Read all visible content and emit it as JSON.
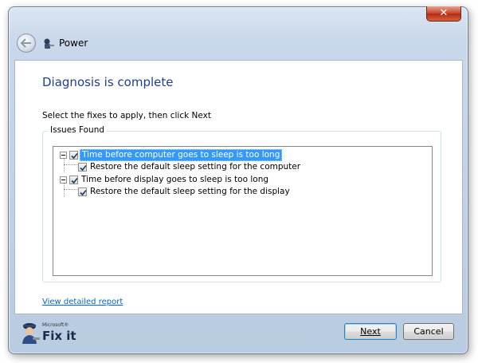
{
  "window": {
    "close_symbol": "✕",
    "title": "Power"
  },
  "header": {
    "back_icon": "back-arrow-icon",
    "app_icon": "fixit-app-icon"
  },
  "main": {
    "heading": "Diagnosis is complete",
    "instruction": "Select the fixes to apply, then click Next",
    "group_label": "Issues Found",
    "tree": [
      {
        "label": "Time before computer goes to sleep is too long",
        "checked": true,
        "selected": true,
        "children": [
          {
            "label": "Restore the default sleep setting for the computer",
            "checked": true
          }
        ]
      },
      {
        "label": "Time before display goes to sleep is too long",
        "checked": true,
        "selected": false,
        "children": [
          {
            "label": "Restore the default sleep setting for the display",
            "checked": true
          }
        ]
      }
    ],
    "report_link": "View detailed report"
  },
  "footer": {
    "brand_small": "Microsoft®",
    "brand": "Fix it",
    "next_label": "Next",
    "cancel_label": "Cancel"
  },
  "colors": {
    "heading": "#1e3f8b",
    "link": "#0066cc",
    "selection": "#3399ff",
    "close_button": "#c7432a"
  }
}
